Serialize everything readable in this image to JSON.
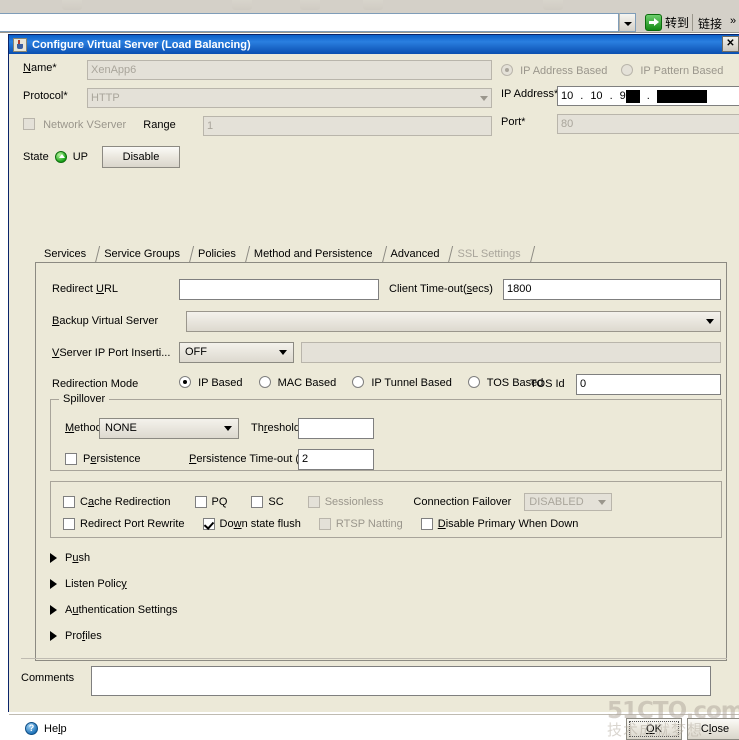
{
  "browser": {
    "address_value": "",
    "go_label": "转到",
    "links_label": "链接",
    "links_chevron": "»"
  },
  "dialog": {
    "title": "Configure Virtual Server (Load Balancing)",
    "close_glyph": "✕",
    "icon": "java-coffee-cup-icon"
  },
  "form": {
    "name_label": "Name*",
    "name_value": "XenApp6",
    "protocol_label": "Protocol*",
    "protocol_value": "HTTP",
    "network_vserver_label": "Network VServer",
    "network_vserver_checked": false,
    "range_label": "Range",
    "range_value": "1",
    "state_label": "State",
    "state_value": "UP",
    "disable_button": "Disable",
    "ip_address_based_label": "IP Address Based",
    "ip_pattern_based_label": "IP Pattern Based",
    "ip_mode_selected": "IP Address Based",
    "ip_address_label": "IP Address*",
    "ip_octet1": "10",
    "ip_octet2": "10",
    "ip_octet3": "9",
    "ip_octet3_redacted": true,
    "ip_octet4_redacted": true,
    "port_label": "Port*",
    "port_value": "80"
  },
  "tabs": [
    {
      "label": "Services",
      "active": false,
      "disabled": false
    },
    {
      "label": "Service Groups",
      "active": false,
      "disabled": false
    },
    {
      "label": "Policies",
      "active": false,
      "disabled": false
    },
    {
      "label": "Method and Persistence",
      "active": false,
      "disabled": false
    },
    {
      "label": "Advanced",
      "active": true,
      "disabled": false
    },
    {
      "label": "SSL Settings",
      "active": false,
      "disabled": true
    }
  ],
  "advanced": {
    "redirect_url_label": "Redirect URL",
    "redirect_url_value": "",
    "client_timeout_label": "Client Time-out(secs)",
    "client_timeout_value": "1800",
    "backup_vserver_label": "Backup Virtual Server",
    "backup_vserver_value": "",
    "vserver_ip_port_label": "VServer IP Port Inserti...",
    "vserver_ip_port_value": "OFF",
    "vserver_ip_port_text": "",
    "redirection_mode_label": "Redirection Mode",
    "redirection_modes": [
      {
        "label": "IP Based",
        "selected": true
      },
      {
        "label": "MAC Based",
        "selected": false
      },
      {
        "label": "IP Tunnel Based",
        "selected": false
      },
      {
        "label": "TOS Based",
        "selected": false
      }
    ],
    "tos_id_label": "TOS Id",
    "tos_id_value": "0",
    "spillover": {
      "group_title": "Spillover",
      "method_label": "Method",
      "method_value": "NONE",
      "threshold_label": "Threshold",
      "threshold_value": "",
      "persistence_label": "Persistence",
      "persistence_checked": false,
      "persistence_timeout_label": "Persistence Time-out (min)",
      "persistence_timeout_value": "2"
    },
    "flags_row1": [
      {
        "label": "Cache Redirection",
        "checked": false,
        "disabled": false
      },
      {
        "label": "PQ",
        "checked": false,
        "disabled": false
      },
      {
        "label": "SC",
        "checked": false,
        "disabled": false
      },
      {
        "label": "Sessionless",
        "checked": false,
        "disabled": true
      }
    ],
    "connection_failover_label": "Connection Failover",
    "connection_failover_value": "DISABLED",
    "flags_row2": [
      {
        "label": "Redirect Port Rewrite",
        "checked": false,
        "disabled": false
      },
      {
        "label": "Down state flush",
        "checked": true,
        "disabled": false
      },
      {
        "label": "RTSP Natting",
        "checked": false,
        "disabled": true
      },
      {
        "label": "Disable Primary When Down",
        "checked": false,
        "disabled": false
      }
    ],
    "sections": [
      {
        "label": "Push",
        "expanded": false
      },
      {
        "label": "Listen Policy",
        "expanded": false
      },
      {
        "label": "Authentication Settings",
        "expanded": false
      },
      {
        "label": "Profiles",
        "expanded": false
      }
    ]
  },
  "footer": {
    "comments_label": "Comments",
    "comments_value": "",
    "help_label": "Help",
    "help_glyph": "?",
    "ok_label": "OK",
    "close_label": "Close"
  },
  "watermark": {
    "line1": "51CTO.com",
    "line2": "技术成就梦想"
  },
  "colors": {
    "titlebar_accent": "#0a5ec6",
    "dialog_bg": "#ece9d8",
    "state_up": "#18a318",
    "go_button": "#158a15"
  }
}
